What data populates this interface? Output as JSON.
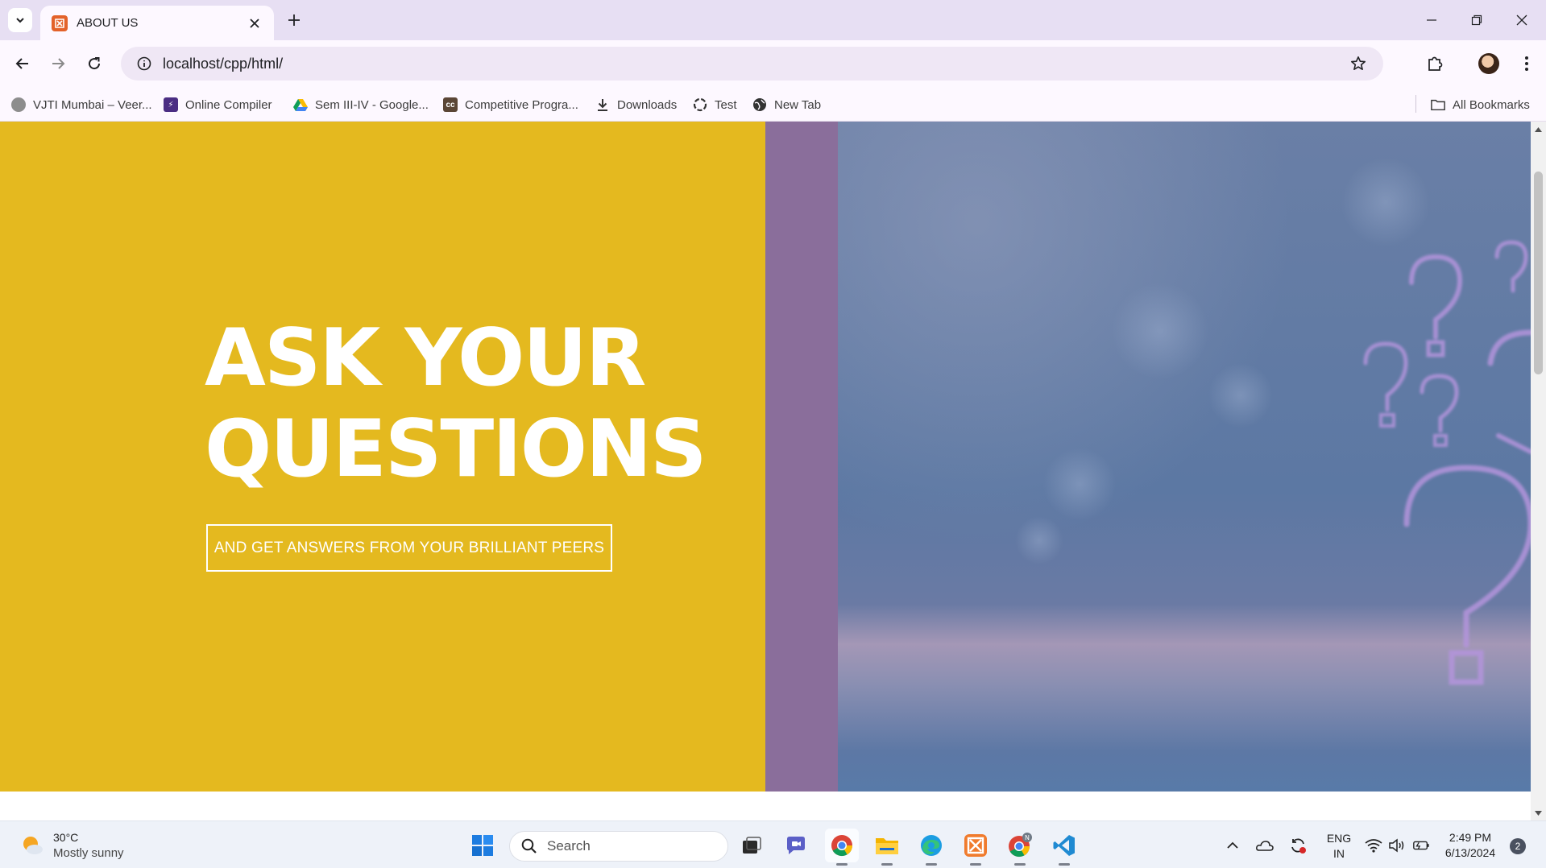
{
  "browser": {
    "tab": {
      "title": "ABOUT US"
    },
    "url": "localhost/cpp/html/",
    "bookmarks": [
      {
        "label": "VJTI Mumbai – Veer...",
        "icon": "vjti-logo-icon"
      },
      {
        "label": "Online Compiler",
        "icon": "lightning-icon"
      },
      {
        "label": "Sem III-IV - Google...",
        "icon": "google-drive-icon"
      },
      {
        "label": "Competitive Progra...",
        "icon": "cc-icon"
      },
      {
        "label": "Downloads",
        "icon": "download-icon"
      },
      {
        "label": "Test",
        "icon": "openai-icon"
      },
      {
        "label": "New Tab",
        "icon": "globe-icon"
      }
    ],
    "all_bookmarks": "All Bookmarks"
  },
  "hero": {
    "title_line1": "ASK YOUR",
    "title_line2": "QUESTIONS",
    "button_label": "AND GET ANSWERS FROM YOUR BRILLIANT PEERS",
    "colors": {
      "left_panel": "#e4b91f",
      "strip": "#8a6e9b",
      "image_tint": "#5c78a3",
      "question_marks": "#b494dc"
    }
  },
  "taskbar": {
    "weather": {
      "temp": "30°C",
      "condition": "Mostly sunny"
    },
    "search_label": "Search",
    "language": {
      "line1": "ENG",
      "line2": "IN"
    },
    "clock": {
      "time": "2:49 PM",
      "date": "6/13/2024"
    },
    "notification_count": "2"
  }
}
